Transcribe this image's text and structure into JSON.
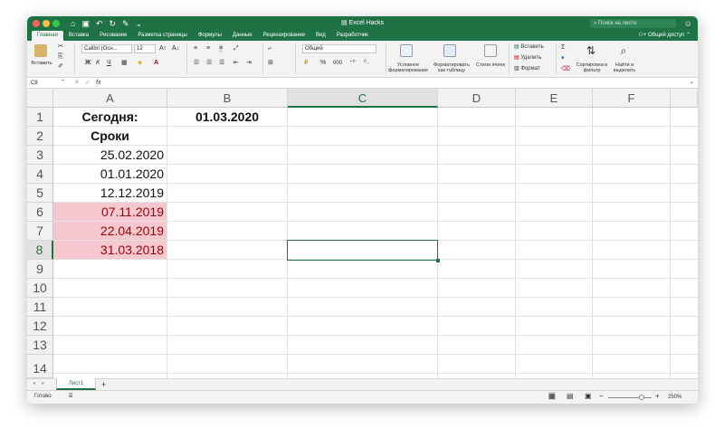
{
  "window": {
    "title": "Excel Hacks",
    "search_placeholder": "Поиск на листе",
    "share_label": "Общий доступ"
  },
  "ribbon_tabs": [
    "Главная",
    "Вставка",
    "Рисование",
    "Разметка страницы",
    "Формулы",
    "Данные",
    "Рецензирование",
    "Вид",
    "Разработчик"
  ],
  "ribbon": {
    "paste_label": "Вставить",
    "font_name": "Calibri (Осн...",
    "font_size": "12",
    "number_format": "Общий",
    "cond_format_label": "Условное форматирование",
    "format_table_label": "Форматировать как таблицу",
    "cell_styles_label": "Стили ячеек",
    "insert_label": "Вставить",
    "delete_label": "Удалить",
    "format_label": "Формат",
    "sort_filter_label": "Сортировка и фильтр",
    "find_select_label": "Найти и выделить",
    "bold": "Ж",
    "italic": "К",
    "underline": "Ч",
    "percent": "%",
    "thousands": "000"
  },
  "formula_bar": {
    "name_box": "C8",
    "fx": "fx",
    "value": ""
  },
  "columns": [
    "A",
    "B",
    "C",
    "D",
    "E",
    "F"
  ],
  "rows": [
    "1",
    "2",
    "3",
    "4",
    "5",
    "6",
    "7",
    "8",
    "9",
    "10",
    "11",
    "12",
    "13",
    "14"
  ],
  "cells": {
    "A1": "Сегодня:",
    "B1": "01.03.2020",
    "A2": "Сроки",
    "A3": "25.02.2020",
    "A4": "01.01.2020",
    "A5": "12.12.2019",
    "A6": "07.11.2019",
    "A7": "22.04.2019",
    "A8": "31.03.2018"
  },
  "highlight_color": "#f5c7ce",
  "highlight_text_color": "#9c0006",
  "accent_color": "#1f7244",
  "selected_cell": "C8",
  "sheet_tabs": [
    "Лист1"
  ],
  "add_sheet": "+",
  "status": {
    "ready": "Готово",
    "zoom": "250%"
  }
}
